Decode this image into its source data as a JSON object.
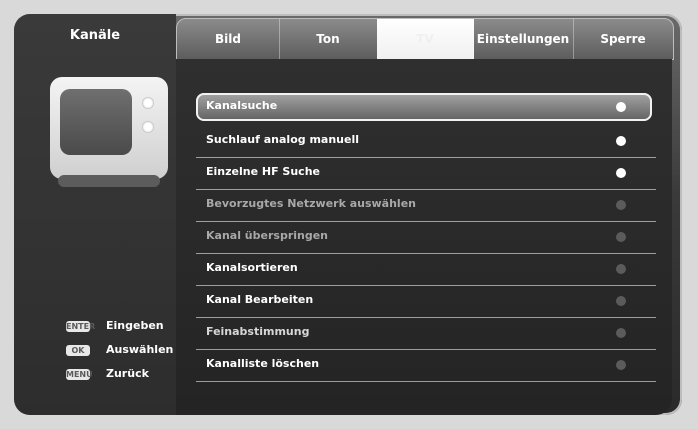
{
  "sidebar": {
    "title": "Kanäle",
    "help": [
      {
        "key": "ENTER",
        "label": "Eingeben"
      },
      {
        "key": "OK",
        "label": "Auswählen"
      },
      {
        "key": "MENU",
        "label": "Zurück"
      }
    ]
  },
  "tabs": [
    {
      "label": "Bild"
    },
    {
      "label": "Ton"
    },
    {
      "label": "TV"
    },
    {
      "label": "Einstellungen"
    },
    {
      "label": "Sperre"
    }
  ],
  "menu": {
    "items": [
      {
        "label": "Kanalsuche"
      },
      {
        "label": "Suchlauf analog manuell"
      },
      {
        "label": "Einzelne HF Suche"
      },
      {
        "label": "Bevorzugtes Netzwerk auswählen"
      },
      {
        "label": "Kanal überspringen"
      },
      {
        "label": "Kanalsortieren"
      },
      {
        "label": "Kanal Bearbeiten"
      },
      {
        "label": "Feinabstimmung"
      },
      {
        "label": "Kanalliste löschen"
      }
    ]
  },
  "colors": {
    "panel_bg": "#2d2d2d",
    "tab_bg": "#6f6f6f",
    "active_tab": "#ffffff",
    "text": "#ffffff",
    "text_dim": "#a8a8a8"
  }
}
